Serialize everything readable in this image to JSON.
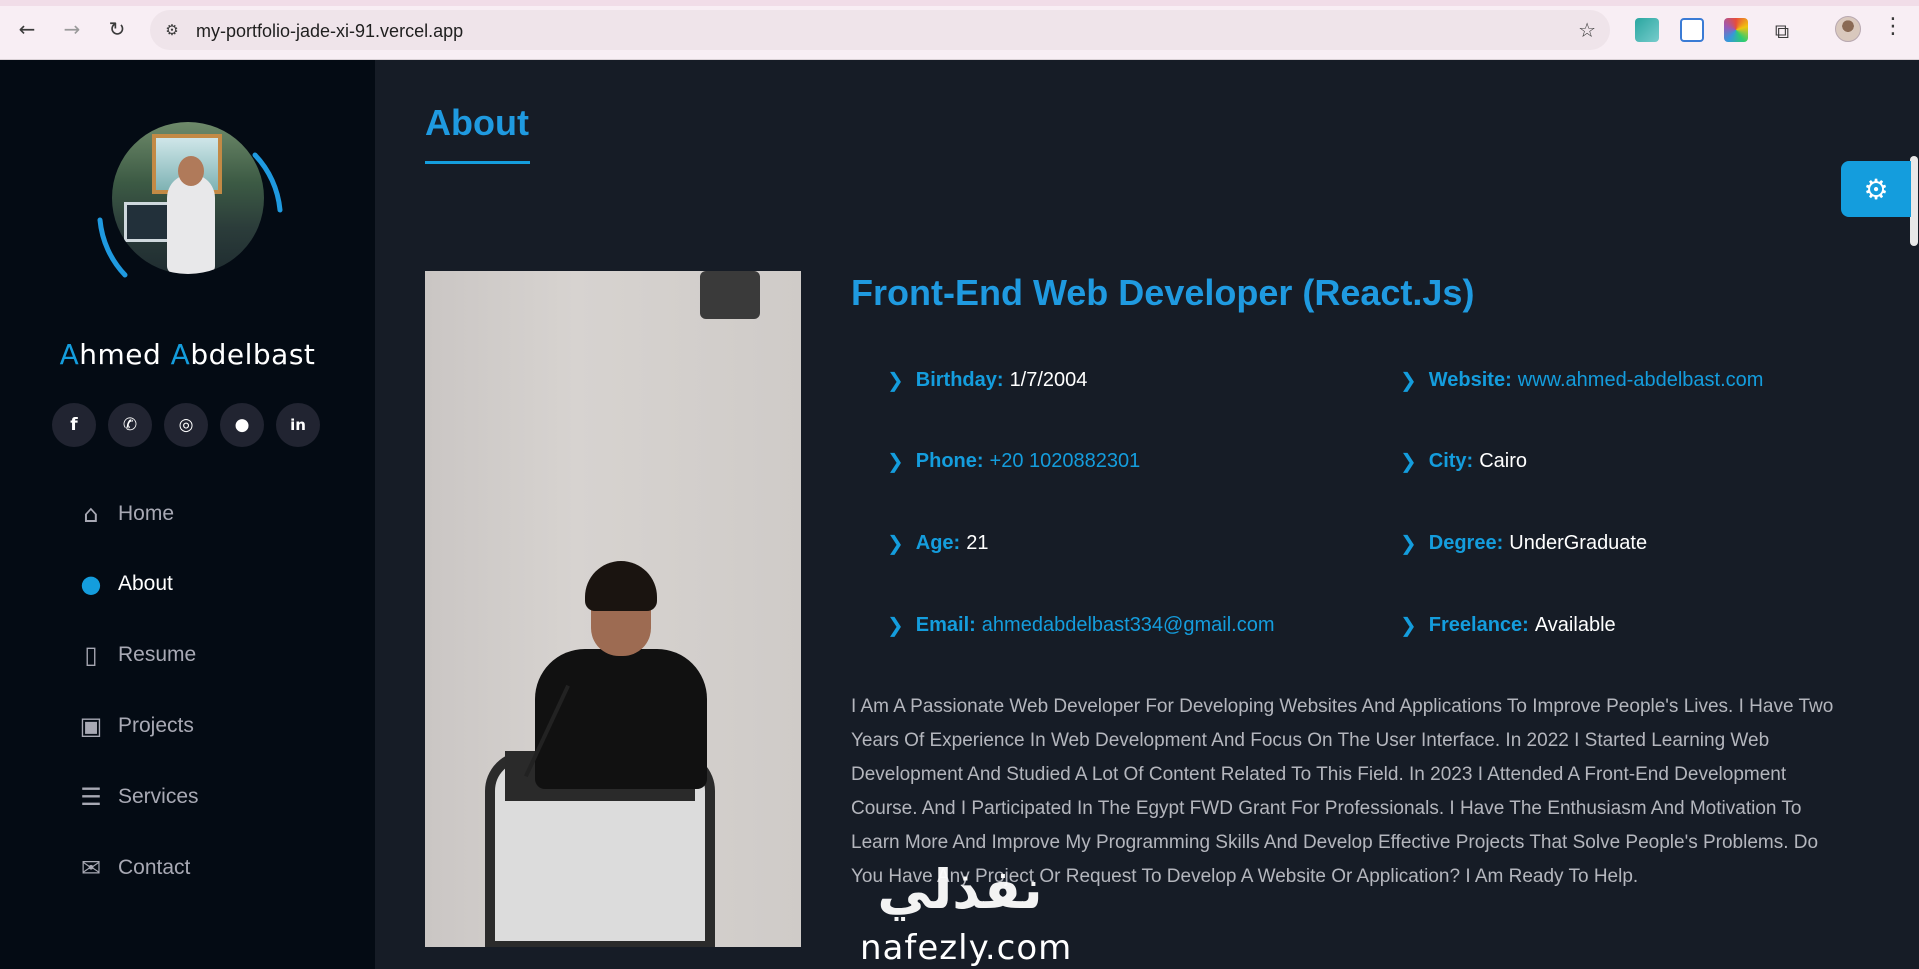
{
  "browser": {
    "url": "my-portfolio-jade-xi-91.vercel.app",
    "icons": {
      "back": "arrow-left-icon",
      "forward": "arrow-right-icon",
      "reload": "reload-icon",
      "site_info": "tune-icon",
      "bookmark": "star-icon",
      "menu": "more-vertical-icon"
    }
  },
  "sidebar": {
    "name_first_initial": "A",
    "name_first_rest": "hmed ",
    "name_last_initial": "A",
    "name_last_rest": "bdelbast",
    "socials": [
      {
        "icon": "facebook-icon",
        "glyph": "f"
      },
      {
        "icon": "whatsapp-icon",
        "glyph": "✆"
      },
      {
        "icon": "instagram-icon",
        "glyph": "◎"
      },
      {
        "icon": "github-icon",
        "glyph": "●"
      },
      {
        "icon": "linkedin-icon",
        "glyph": "in"
      }
    ],
    "nav": [
      {
        "label": "Home",
        "icon": "home-icon",
        "glyph": "⌂",
        "active": false
      },
      {
        "label": "About",
        "icon": "user-icon",
        "glyph": "●",
        "active": true
      },
      {
        "label": "Resume",
        "icon": "file-icon",
        "glyph": "▯",
        "active": false
      },
      {
        "label": "Projects",
        "icon": "portfolio-icon",
        "glyph": "▣",
        "active": false
      },
      {
        "label": "Services",
        "icon": "server-icon",
        "glyph": "☰",
        "active": false
      },
      {
        "label": "Contact",
        "icon": "envelope-icon",
        "glyph": "✉",
        "active": false
      }
    ]
  },
  "main": {
    "section_title": "About",
    "job_title": "Front-End Web Developer (React.Js)",
    "info": {
      "birthday": {
        "label": "Birthday:",
        "value": "1/7/2004"
      },
      "website": {
        "label": "Website:",
        "value": "www.ahmed-abdelbast.com"
      },
      "phone": {
        "label": "Phone:",
        "value": "+20 1020882301"
      },
      "city": {
        "label": "City:",
        "value": "Cairo"
      },
      "age": {
        "label": "Age:",
        "value": "21"
      },
      "degree": {
        "label": "Degree:",
        "value": "UnderGraduate"
      },
      "email": {
        "label": "Email:",
        "value": "ahmedabdelbast334@gmail.com"
      },
      "freelance": {
        "label": "Freelance:",
        "value": "Available"
      }
    },
    "bio": "I Am A Passionate Web Developer For Developing Websites And Applications To Improve People's Lives. I Have Two Years Of Experience In Web Development And Focus On The User Interface. In 2022 I Started Learning Web Development And Studied A Lot Of Content Related To This Field. In 2023 I Attended A Front-End Development Course. And I Participated In The Egypt FWD Grant For Professionals. I Have The Enthusiasm And Motivation To Learn More And Improve My Programming Skills And Develop Effective Projects That Solve People's Problems. Do You Have Any Project Or Request To Develop A Website Or Application? I Am Ready To Help.",
    "theme_toggle_icon": "gear-icon"
  },
  "watermark": {
    "arabic": "نفذلي",
    "latin": "nafezly.com"
  },
  "colors": {
    "accent": "#149ddd",
    "sidebar_bg": "#040b14",
    "main_bg": "#161c26"
  }
}
